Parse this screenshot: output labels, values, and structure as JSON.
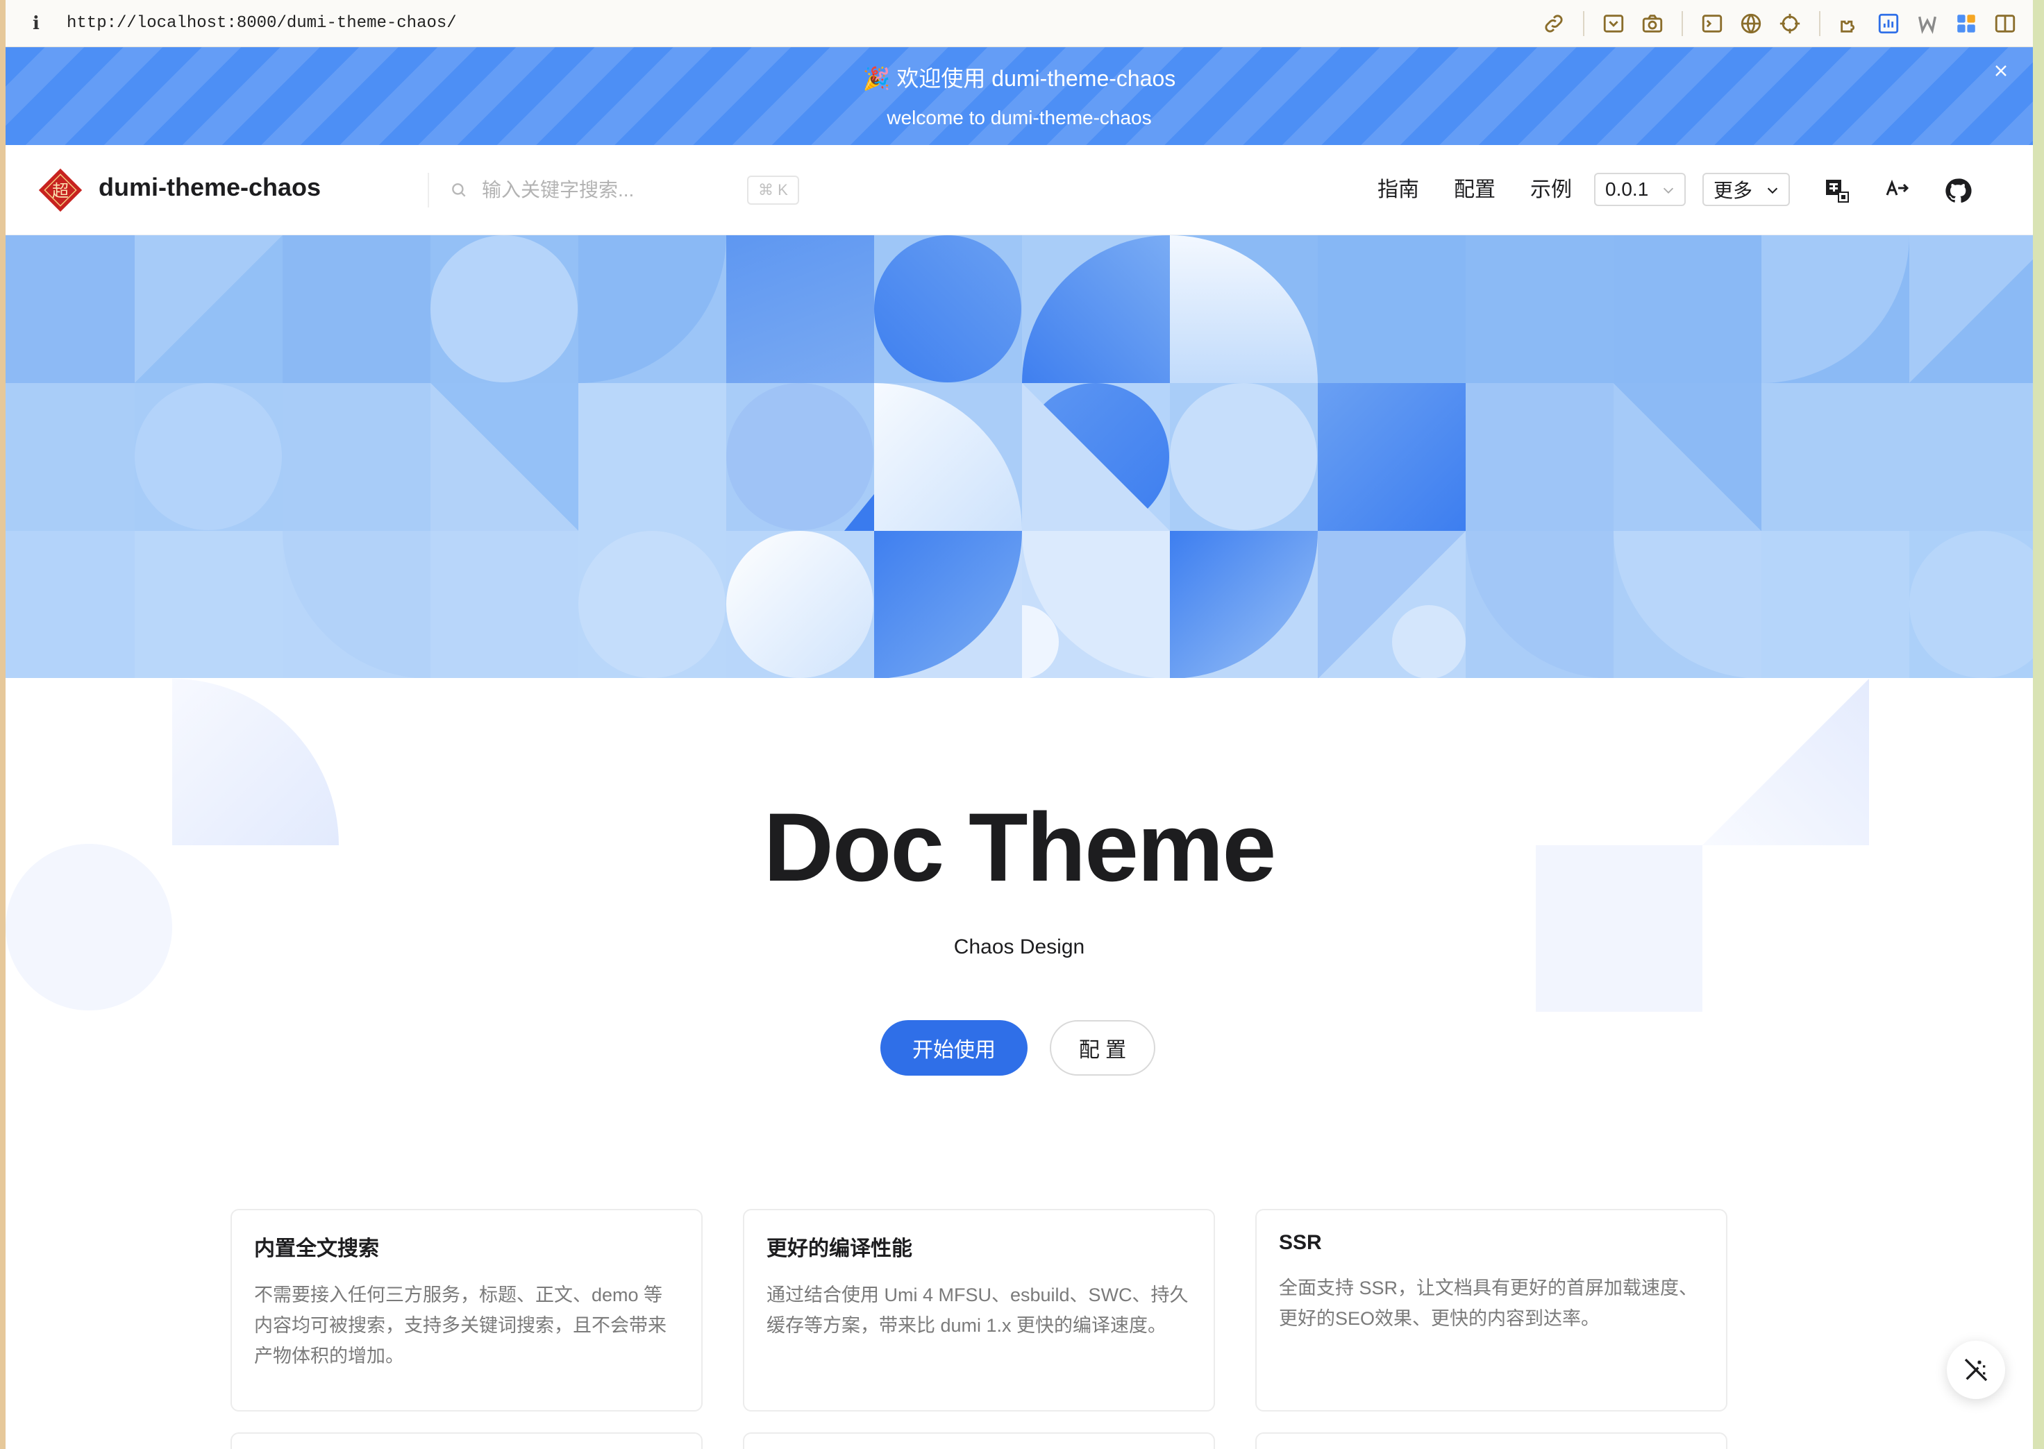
{
  "browser": {
    "url": "http://localhost:8000/dumi-theme-chaos/",
    "info_glyph": "i"
  },
  "banner": {
    "emoji": "🎉",
    "title": "欢迎使用 dumi-theme-chaos",
    "subtitle": "welcome to dumi-theme-chaos"
  },
  "navbar": {
    "logo_text": "超",
    "site_title": "dumi-theme-chaos",
    "search_placeholder": "输入关键字搜索...",
    "search_shortcut": "⌘ K",
    "links": [
      "指南",
      "配置",
      "示例"
    ],
    "version": "0.0.1",
    "more": "更多"
  },
  "hero": {
    "title": "Doc Theme",
    "description": "Chaos Design",
    "primary_action": "开始使用",
    "secondary_action": "配 置"
  },
  "features": [
    {
      "title": "内置全文搜索",
      "description": "不需要接入任何三方服务，标题、正文、demo 等内容均可被搜索，支持多关键词搜索，且不会带来产物体积的增加。"
    },
    {
      "title": "更好的编译性能",
      "description": "通过结合使用 Umi 4 MFSU、esbuild、SWC、持久缓存等方案，带来比 dumi 1.x 更快的编译速度。"
    },
    {
      "title": "SSR",
      "description": "全面支持 SSR，让文档具有更好的首屏加载速度、更好的SEO效果、更快的内容到达率。"
    }
  ],
  "colors": {
    "banner": "#4d8ff5",
    "primary": "#2f6fe8",
    "pattern": "#a8cbf7"
  }
}
